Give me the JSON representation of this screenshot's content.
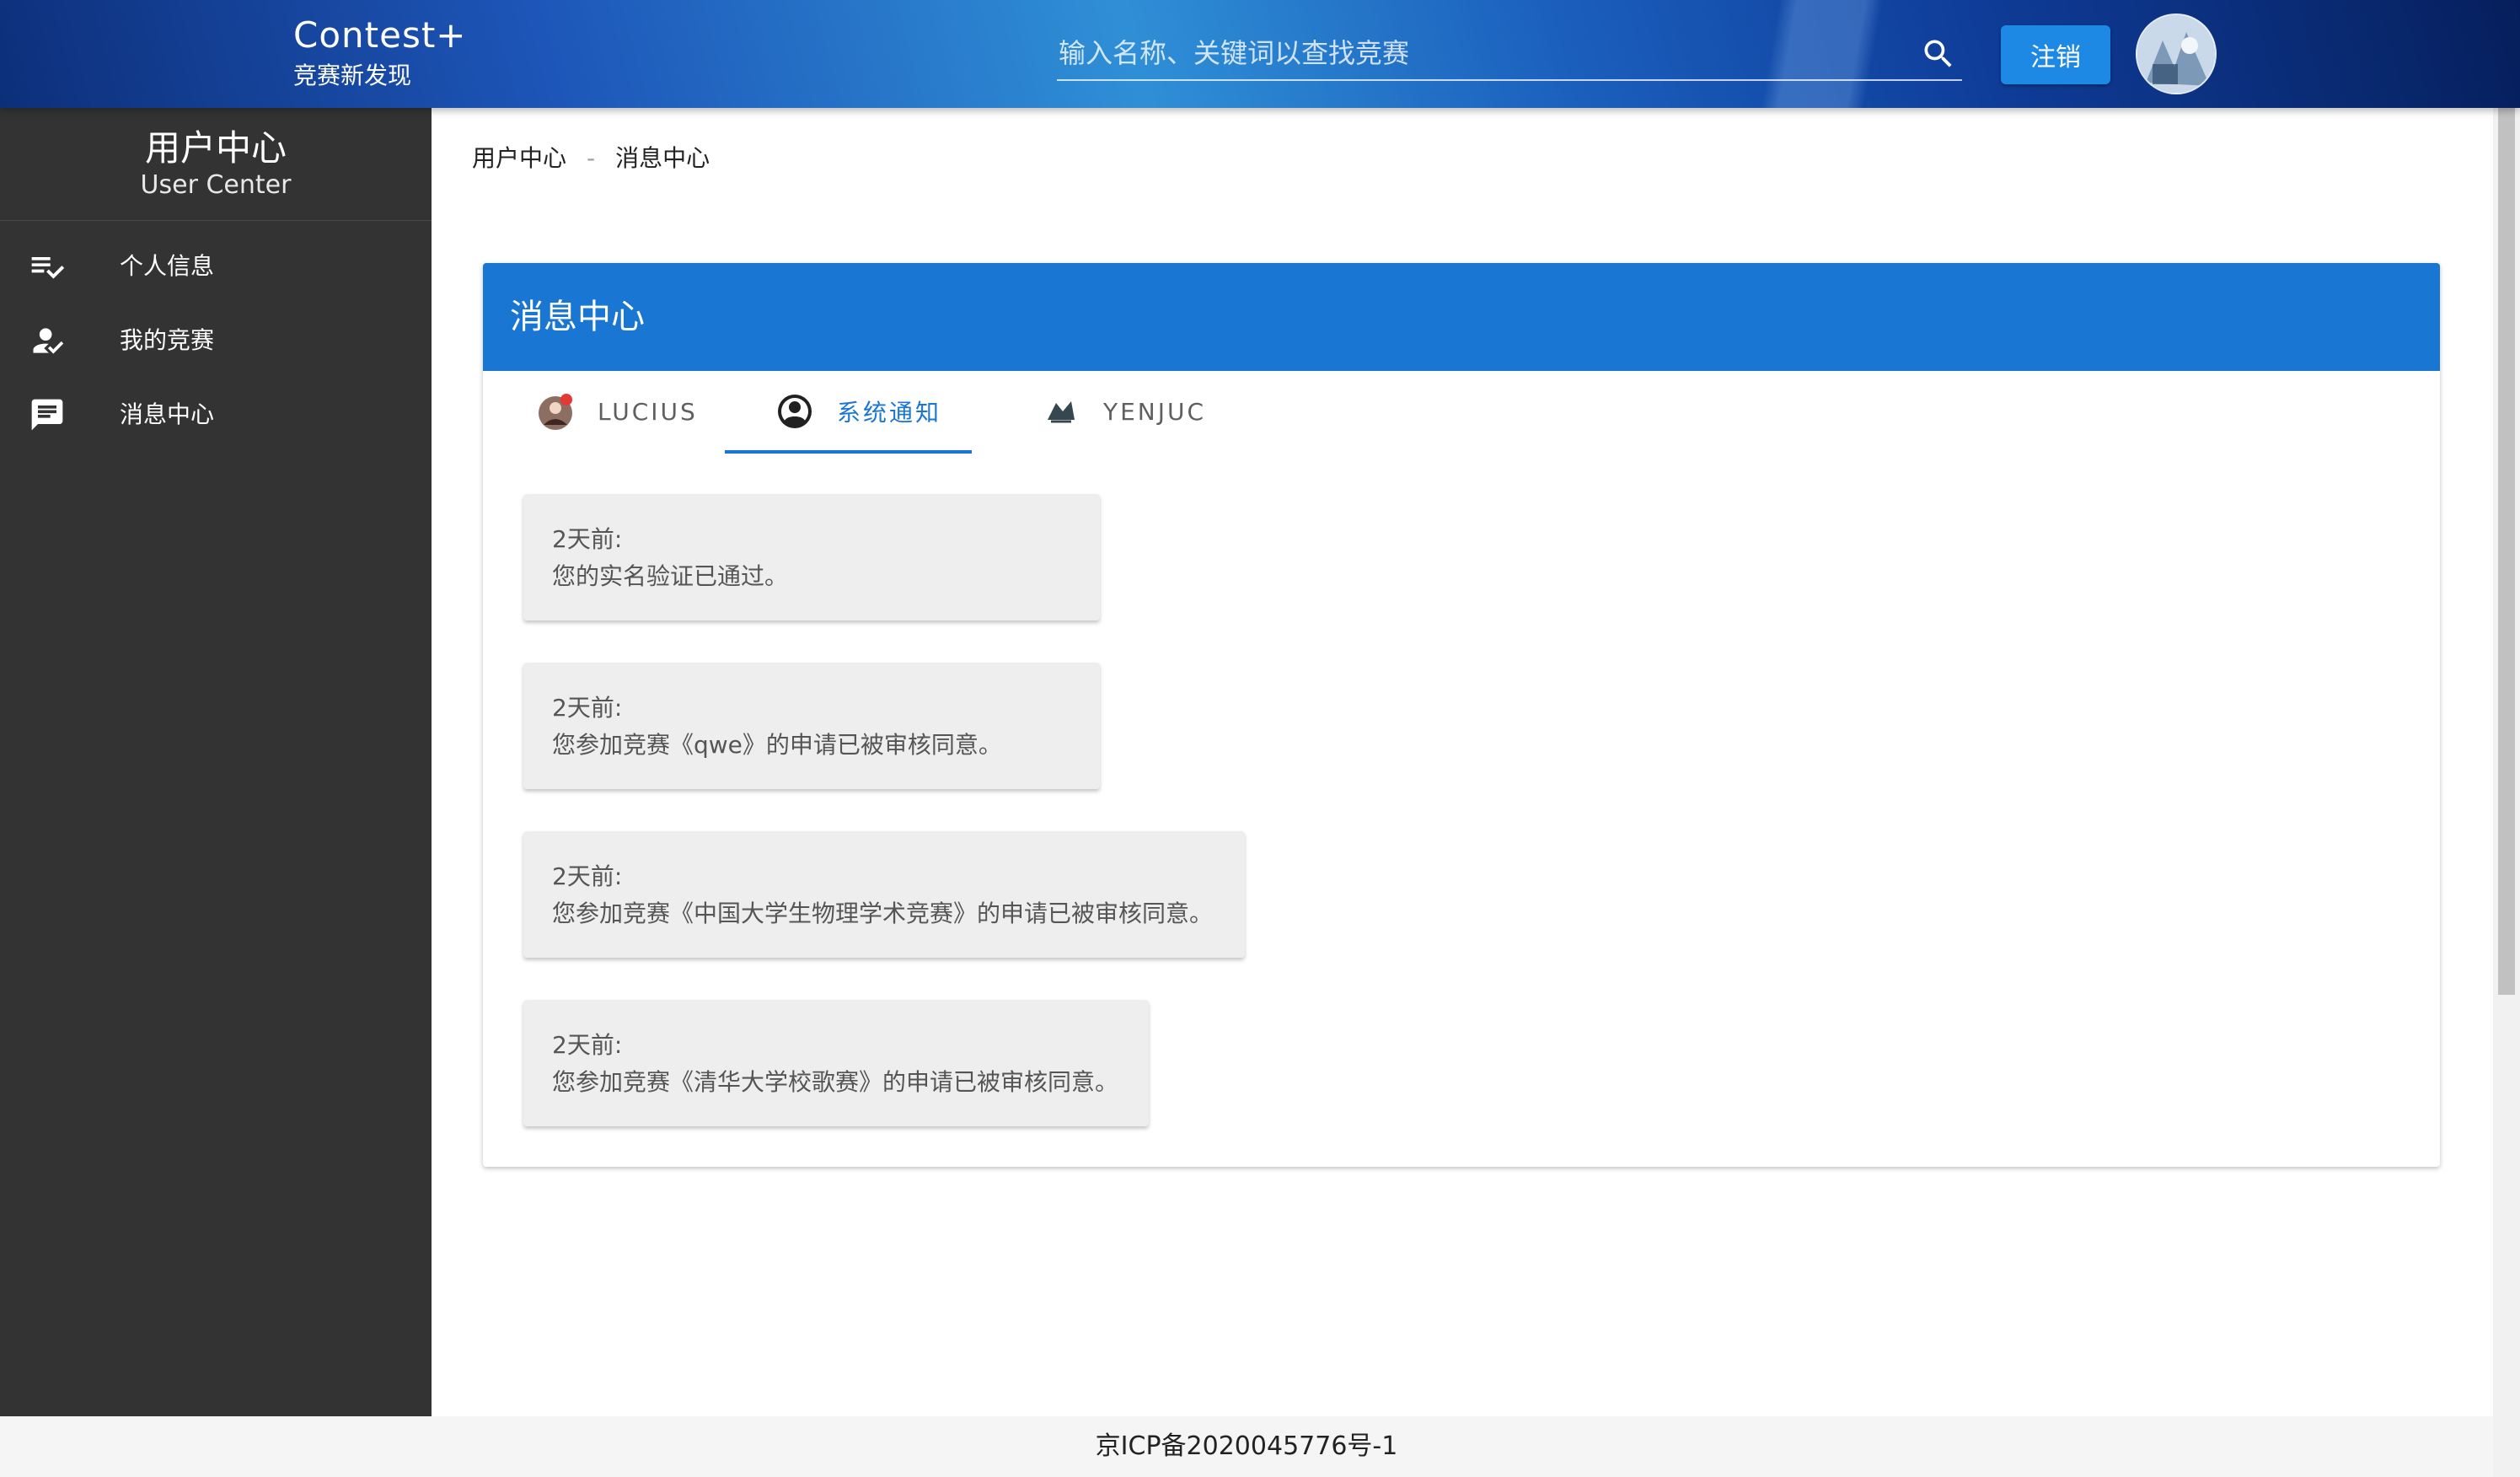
{
  "header": {
    "brand_title": "Contest+",
    "brand_subtitle": "竞赛新发现",
    "search_placeholder": "输入名称、关键词以查找竞赛",
    "logout_label": "注销"
  },
  "sidebar": {
    "title": "用户中心",
    "subtitle": "User Center",
    "items": [
      {
        "label": "个人信息",
        "icon": "playlist-check-icon"
      },
      {
        "label": "我的竞赛",
        "icon": "account-check-icon"
      },
      {
        "label": "消息中心",
        "icon": "message-text-icon"
      }
    ]
  },
  "breadcrumb": {
    "items": [
      "用户中心",
      "消息中心"
    ],
    "separator": "-"
  },
  "panel": {
    "title": "消息中心",
    "tabs": [
      {
        "label": "LUCIUS",
        "icon": "user-avatar",
        "unread": true
      },
      {
        "label": "系统通知",
        "icon": "account-circle-icon",
        "active": true
      },
      {
        "label": "YENJUC",
        "icon": "user-avatar"
      }
    ],
    "messages": [
      {
        "time": "2天前:",
        "text": "您的实名验证已通过。"
      },
      {
        "time": "2天前:",
        "text": "您参加竞赛《qwe》的申请已被审核同意。"
      },
      {
        "time": "2天前:",
        "text": "您参加竞赛《中国大学生物理学术竞赛》的申请已被审核同意。"
      },
      {
        "time": "2天前:",
        "text": "您参加竞赛《清华大学校歌赛》的申请已被审核同意。"
      }
    ]
  },
  "footer": {
    "icp": "京ICP备2020045776号-1"
  },
  "colors": {
    "primary": "#1976d2",
    "button": "#1e88e5",
    "sidebar_bg": "#333333",
    "card_bg": "#eeeeee",
    "unread_dot": "#e53935"
  }
}
